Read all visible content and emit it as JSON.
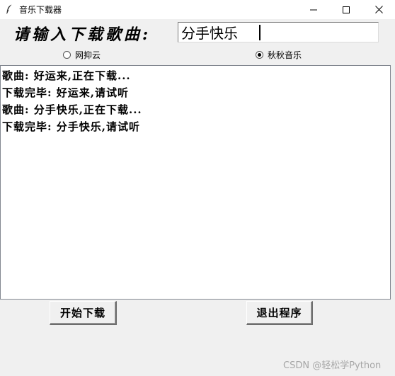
{
  "window": {
    "title": "音乐下载器"
  },
  "prompt": {
    "label": "请输入下载歌曲:",
    "song_value": "分手快乐"
  },
  "sources": [
    {
      "label": "网抑云",
      "checked": false
    },
    {
      "label": "秋秋音乐",
      "checked": true
    }
  ],
  "log": {
    "lines": [
      "歌曲: 好运来,正在下载...",
      "下载完毕: 好运来,请试听",
      "歌曲: 分手快乐,正在下载...",
      "下载完毕: 分手快乐,请试听"
    ]
  },
  "buttons": {
    "start_label": "开始下载",
    "quit_label": "退出程序"
  },
  "watermark": "CSDN @轻松学Python",
  "icons": {
    "app": "feather-icon",
    "minimize": "minimize-icon",
    "maximize": "maximize-icon",
    "close": "close-icon"
  }
}
